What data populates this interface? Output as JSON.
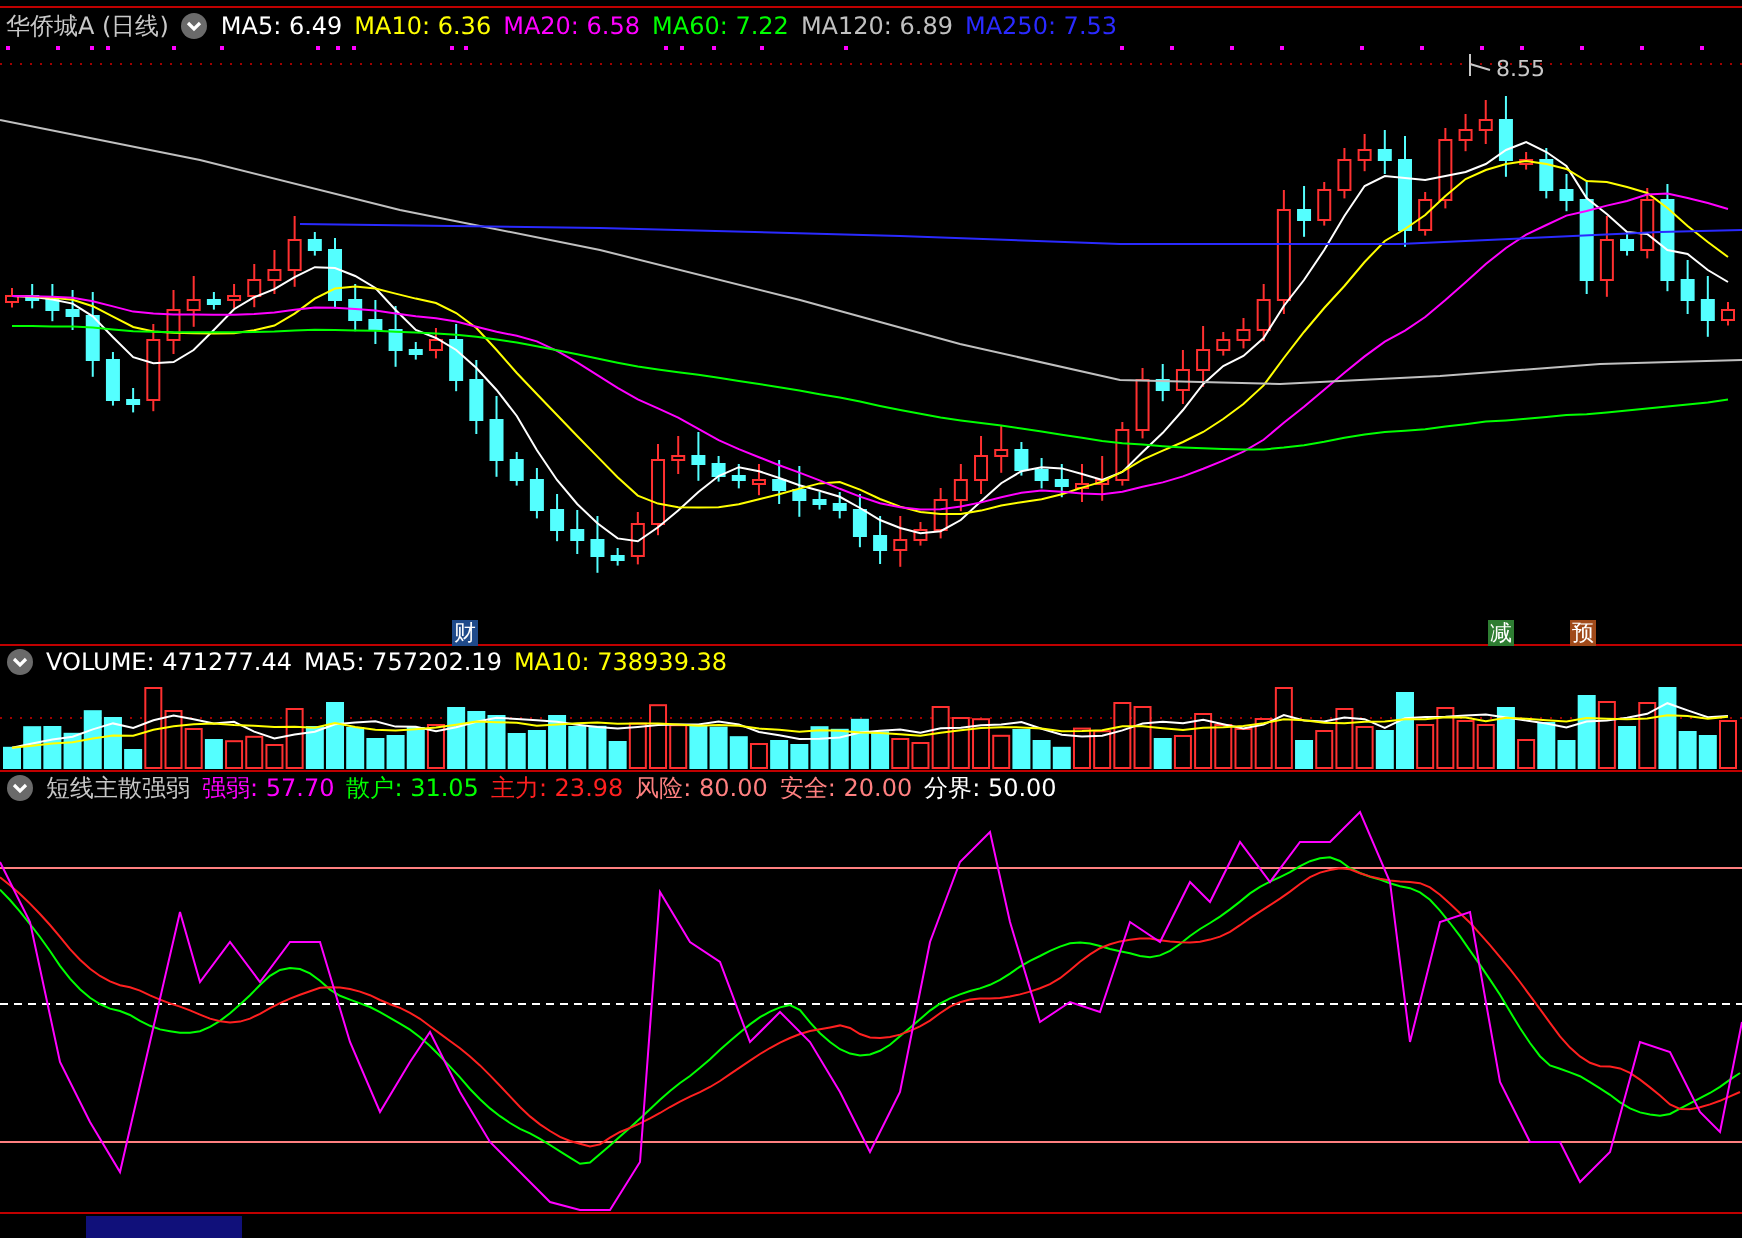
{
  "price_panel": {
    "title": "华侨城A (日线)",
    "indicators": [
      {
        "label": "MA5: 6.49",
        "color": "#ffffff"
      },
      {
        "label": "MA10: 6.36",
        "color": "#ffff00"
      },
      {
        "label": "MA20: 6.58",
        "color": "#ff00ff"
      },
      {
        "label": "MA60: 7.22",
        "color": "#00ff00"
      },
      {
        "label": "MA120: 6.89",
        "color": "#c0c0c0"
      },
      {
        "label": "MA250: 7.53",
        "color": "#2a2aff"
      }
    ],
    "high_label": "8.55",
    "markers": [
      {
        "text": "财",
        "color": "#1f4a8a"
      },
      {
        "text": "减",
        "color": "#2e7d32"
      },
      {
        "text": "预",
        "color": "#a04a1a"
      }
    ]
  },
  "volume_panel": {
    "indicators": [
      {
        "label": "VOLUME: 471277.44",
        "color": "#ffffff"
      },
      {
        "label": "MA5: 757202.19",
        "color": "#ffffff"
      },
      {
        "label": "MA10: 738939.38",
        "color": "#ffff00"
      }
    ]
  },
  "oscillator_panel": {
    "title": "短线主散强弱",
    "indicators": [
      {
        "label": "强弱: 57.70",
        "color": "#ff00ff"
      },
      {
        "label": "散户: 31.05",
        "color": "#00ff00"
      },
      {
        "label": "主力: 23.98",
        "color": "#ff2020"
      },
      {
        "label": "风险: 80.00",
        "color": "#ff8080"
      },
      {
        "label": "安全: 20.00",
        "color": "#ff8080"
      },
      {
        "label": "分界: 50.00",
        "color": "#ffffff"
      }
    ]
  }
}
